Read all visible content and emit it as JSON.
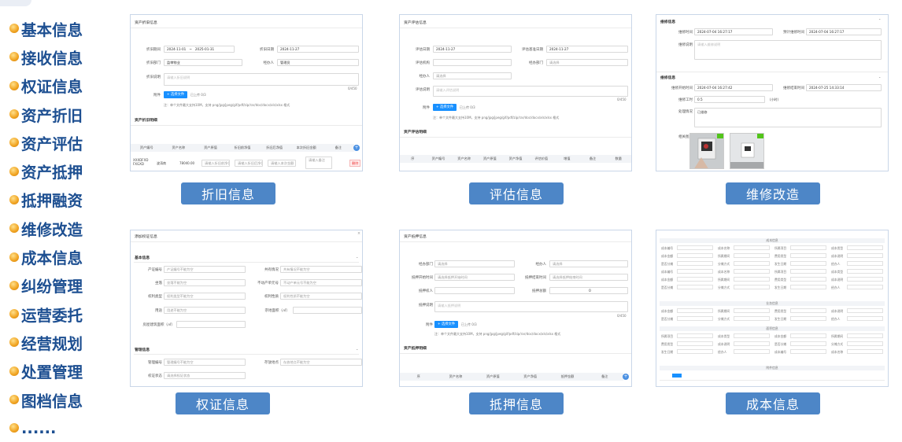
{
  "sidebar": {
    "items": [
      "基本信息",
      "接收信息",
      "权证信息",
      "资产折旧",
      "资产评估",
      "资产抵押",
      "抵押融资",
      "维修改造",
      "成本信息",
      "纠纷管理",
      "运营委托",
      "经营规划",
      "处置管理",
      "图档信息",
      "......"
    ]
  },
  "labels": {
    "depreciation": "折旧信息",
    "evaluation": "评估信息",
    "repair": "维修改造",
    "warrant": "权证信息",
    "mortgage": "抵押信息",
    "cost": "成本信息"
  },
  "depr": {
    "title": "资产折旧信息",
    "date_label": "折旧期间",
    "date_from": "2024-11-01",
    "date_sep": "~",
    "date_to": "2025-01-31",
    "book_label": "折旧日期",
    "book_date": "2024-11-27",
    "dept_label": "折旧部门",
    "dept_value": "监审物业",
    "handler_label": "经办人",
    "handler_value": "管理员",
    "desc_label": "折旧说明",
    "desc_ph": "请输入折旧说明",
    "count": "0/450",
    "attach_label": "附件",
    "upload": "+ 选择文件",
    "uploaded": "已上传 0/3",
    "tip": "注：单个文件最大支持10M，支持 png/jpg/jpeg/gif/pdf/zip/rar/doc/docx/xls/xlsx 格式",
    "detail_title": "资产折旧明细",
    "cols": [
      "资产编号",
      "资产名称",
      "资产原值",
      "折旧前净值",
      "折旧后净值",
      "本次折旧金额",
      "备注"
    ],
    "row": {
      "code": "XXXDFXD FXGXD",
      "name": "波涛南",
      "value": "78040.00",
      "ph1": "请输入折旧前净值",
      "ph2": "请输入折旧后净值",
      "ph3": "请输入本次金额",
      "ph4": "请输入备注",
      "del": "删除"
    }
  },
  "eval": {
    "title": "资产评估信息",
    "date_label": "评估日期",
    "date": "2024-11-27",
    "base_label": "评估基准日期",
    "base_date": "2024-11-27",
    "org_label": "评估机构",
    "dept_label": "经办部门",
    "dept_ph": "请选择",
    "handler_label": "经办人",
    "handler_ph": "请选择",
    "desc_label": "评估说明",
    "desc_ph": "请输入评估说明",
    "count": "0/450",
    "attach_label": "附件",
    "upload": "+ 选择文件",
    "uploaded": "已上传 0/3",
    "tip": "注：单个文件最大支持10M，支持 png/jpg/jpeg/gif/pdf/zip/rar/doc/docx/xls/xlsx 格式",
    "detail_title": "资产评估明细",
    "cols": [
      "序",
      "资产编号",
      "资产名称",
      "资产原值",
      "资产净值",
      "评估价值",
      "增值",
      "备注",
      "数量"
    ]
  },
  "repair": {
    "sec1": "维修信息",
    "start_label": "维修时间",
    "start": "2024-07-04 16:27:17",
    "plan_label": "预计维修时间",
    "plan": "2024-07-04 16:27:17",
    "desc_label": "维修说明",
    "desc_ph": "请输入维修说明",
    "sec2": "维修信息",
    "rs_label": "维修开始时间",
    "rs": "2024-07-04 16:27:42",
    "re_label": "维修结束时间",
    "re": "2024-07-25 14:33:14",
    "dur_label": "维修工时",
    "dur": "0.5",
    "unit": "(小时)",
    "sit_label": "处理情况",
    "sit": "已维修",
    "img_label": "相关图片"
  },
  "warrant": {
    "title": "添加权证信息",
    "close": "×",
    "sec1": "基本信息",
    "f1": "产证编号",
    "p1": "产证编号不能为空",
    "f2": "共有情况",
    "p2": "共有情况不能为空",
    "f3": "坐落",
    "p3": "坐落不能为空",
    "f4": "不动产单元号",
    "p4": "不动产单元号不能为空",
    "f5": "权利类型",
    "p5": "权利类型不能为空",
    "f6": "权利性质",
    "p6": "权利性质不能为空",
    "f7": "用途",
    "p7": "用途不能为空",
    "f8": "宗地面积（㎡）",
    "f9": "房屋建筑面积（㎡）",
    "sec2": "管理信息",
    "f10": "管理编号",
    "p10": "管理编号不能为空",
    "f11": "存放地点",
    "p11": "存放地点不能为空",
    "f12": "权证状态",
    "p12": "请选择权证状态"
  },
  "mort": {
    "title": "资产抵押信息",
    "dept_label": "经办部门",
    "dept_ph": "请选择",
    "handler_label": "经办人",
    "handler_ph": "请选择",
    "start_label": "抵押开始时间",
    "start_ph": "请选择抵押开始时间",
    "end_label": "抵押结束时间",
    "end_ph": "请选择抵押结束时间",
    "person_label": "抵押权人",
    "amount_label": "抵押总额",
    "amount": "0",
    "desc_label": "抵押说明",
    "desc_ph": "请输入抵押说明",
    "count": "0/450",
    "attach_label": "附件",
    "upload": "+ 选择文件",
    "uploaded": "已上传 0/3",
    "tip": "注：单个文件最大支持10M，支持 png/jpg/jpeg/gif/pdf/zip/rar/doc/docx/xls/xlsx 格式",
    "detail_title": "资产抵押明细",
    "cols": [
      "序",
      "资产名称",
      "资产原值",
      "资产净值",
      "抵押金额",
      "备注"
    ]
  },
  "cost": {
    "sec1": "成本信息",
    "sec2": "业务信息",
    "sec3": "面积信息",
    "sec4": "附件信息",
    "r": [
      "成本编号",
      "成本名称",
      "所属项目",
      "成本类型",
      "成本金额",
      "所属期间",
      "费用类型",
      "成本说明",
      "是否分摊",
      "分摊方式",
      "发生日期",
      "经办人"
    ]
  }
}
